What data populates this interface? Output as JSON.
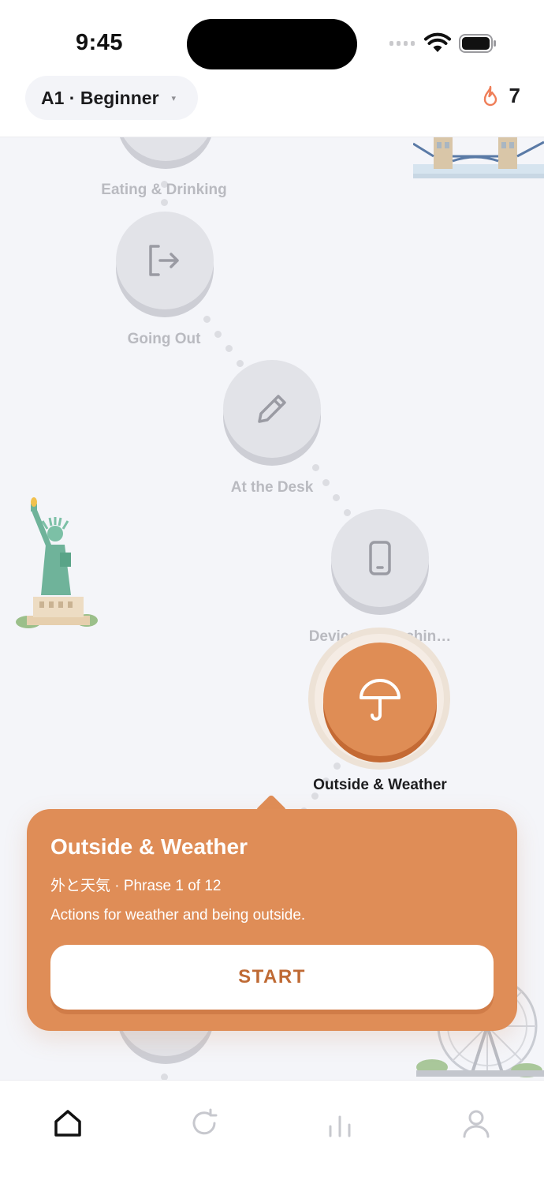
{
  "status_bar": {
    "time": "9:45"
  },
  "header": {
    "level_label": "A1 · Beginner",
    "level_caret": "▾",
    "streak_count": "7"
  },
  "path": {
    "nodes": [
      {
        "label": "Eating & Drinking",
        "icon": "utensils-icon",
        "state": "locked"
      },
      {
        "label": "Going Out",
        "icon": "exit-icon",
        "state": "locked"
      },
      {
        "label": "At the Desk",
        "icon": "pencil-icon",
        "state": "locked"
      },
      {
        "label": "Devices & Machin…",
        "icon": "phone-icon",
        "state": "locked"
      },
      {
        "label": "Outside & Weather",
        "icon": "umbrella-icon",
        "state": "active"
      }
    ],
    "landmarks": [
      "tower-bridge",
      "statue-of-liberty",
      "ferris-wheel"
    ]
  },
  "popup": {
    "title": "Outside & Weather",
    "subtitle": "外と天気 · Phrase 1 of 12",
    "description": "Actions for weather and being outside.",
    "start_label": "START"
  },
  "tabbar": {
    "tabs": [
      {
        "icon": "home-icon",
        "active": true
      },
      {
        "icon": "refresh-icon",
        "active": false
      },
      {
        "icon": "stats-icon",
        "active": false
      },
      {
        "icon": "profile-icon",
        "active": false
      }
    ]
  },
  "colors": {
    "accent": "#df8d57",
    "accent_dark": "#c46a34",
    "button_text": "#bf6a34",
    "locked_node": "#e2e3e8",
    "locked_label": "#b9bac0",
    "background": "#f4f5f9"
  }
}
